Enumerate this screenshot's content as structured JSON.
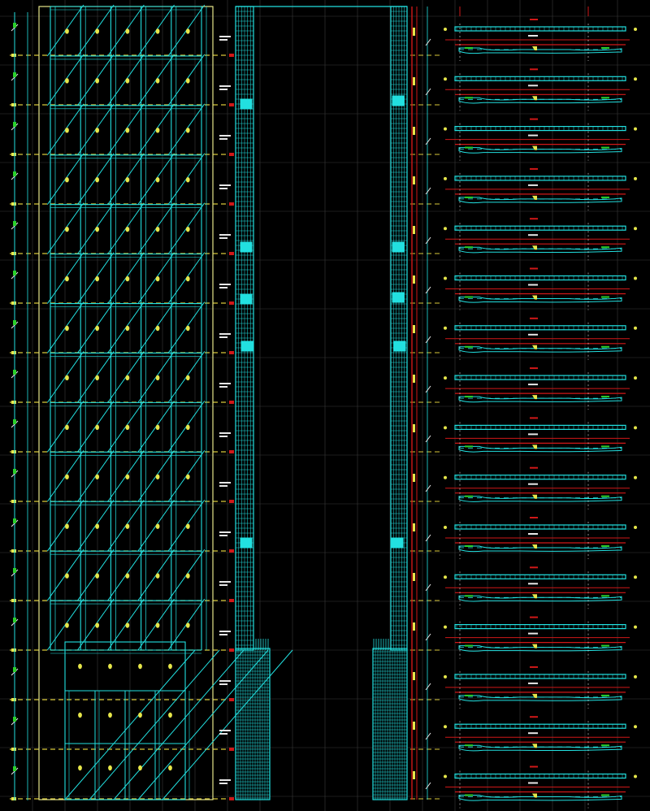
{
  "drawing": {
    "background": "#000000",
    "colors": {
      "grid": "#3a3a3a",
      "frame": "#e6e68a",
      "structure": "#22e0e0",
      "level_line": "#d8c83a",
      "markers": "#e6e64a",
      "red": "#d01818",
      "white": "#e8e8e8",
      "green": "#2ad02a"
    },
    "icons": [
      "dimension-tick-icon",
      "section-marker-icon",
      "level-tag-icon"
    ]
  },
  "elevation_view": {
    "bays_upper": 5,
    "levels_upper": 13,
    "bays_lower": 4,
    "levels_lower": 3
  },
  "section_view": {
    "storeys": 16,
    "dense_base_storeys": 3
  },
  "plan_details": {
    "rows": 16
  }
}
